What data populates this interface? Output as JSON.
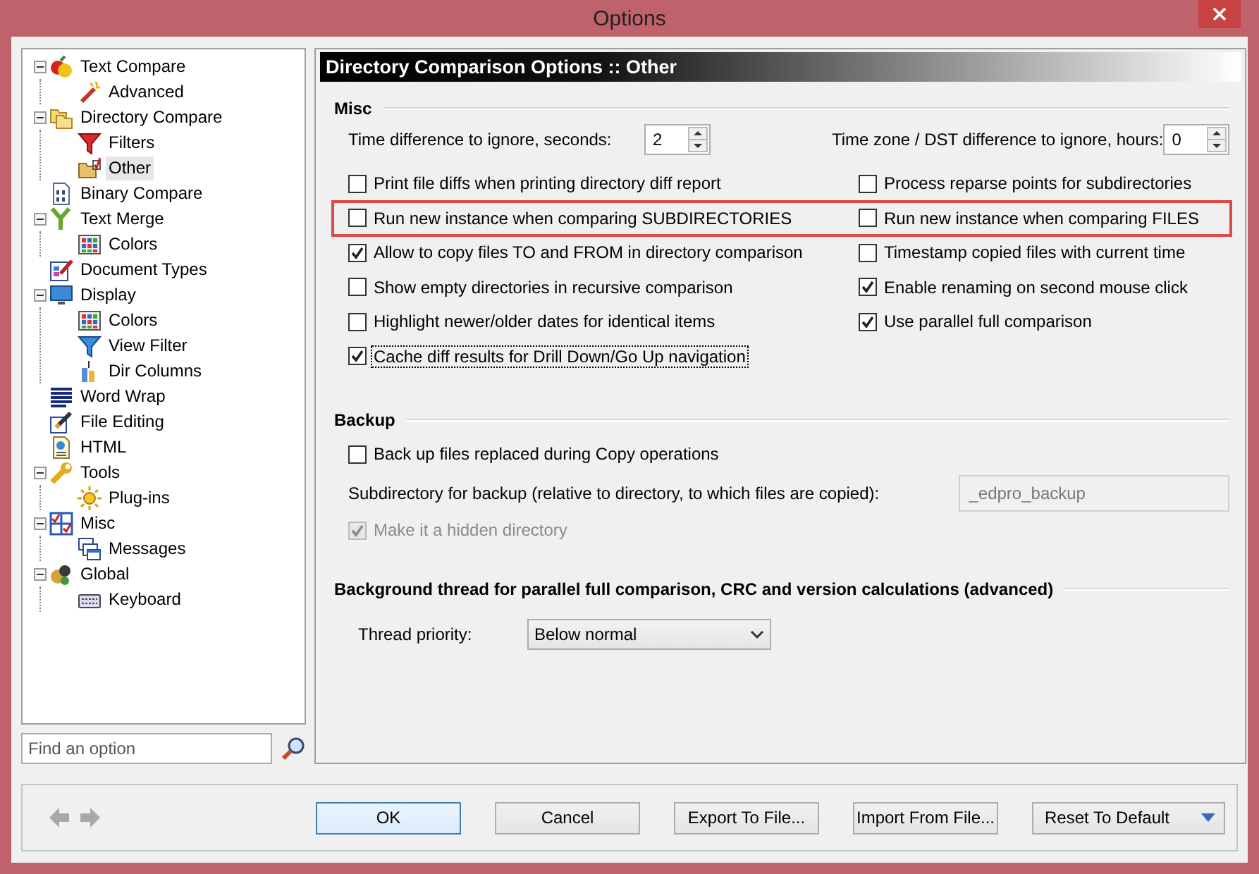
{
  "window": {
    "title": "Options"
  },
  "tree": [
    {
      "label": "Text Compare",
      "kind": "fruit",
      "expanded": true,
      "selected": false,
      "children": [
        {
          "label": "Advanced",
          "kind": "wand",
          "selected": false
        }
      ]
    },
    {
      "label": "Directory Compare",
      "kind": "folders",
      "expanded": true,
      "selected": false,
      "children": [
        {
          "label": "Filters",
          "kind": "funnel",
          "selected": false
        },
        {
          "label": "Other",
          "kind": "folder",
          "selected": true
        }
      ]
    },
    {
      "label": "Binary Compare",
      "kind": "binary",
      "selected": false
    },
    {
      "label": "Text Merge",
      "kind": "merge",
      "expanded": true,
      "selected": false,
      "children": [
        {
          "label": "Colors",
          "kind": "grid",
          "selected": false
        }
      ]
    },
    {
      "label": "Document Types",
      "kind": "doctypes",
      "selected": false
    },
    {
      "label": "Display",
      "kind": "monitor",
      "expanded": true,
      "selected": false,
      "children": [
        {
          "label": "Colors",
          "kind": "grid",
          "selected": false
        },
        {
          "label": "View Filter",
          "kind": "bluefunnel",
          "selected": false
        },
        {
          "label": "Dir Columns",
          "kind": "columns",
          "selected": false
        }
      ]
    },
    {
      "label": "Word Wrap",
      "kind": "lines",
      "selected": false
    },
    {
      "label": "File Editing",
      "kind": "pen",
      "selected": false
    },
    {
      "label": "HTML",
      "kind": "page",
      "selected": false
    },
    {
      "label": "Tools",
      "kind": "wrench",
      "expanded": true,
      "selected": false,
      "children": [
        {
          "label": "Plug-ins",
          "kind": "sun",
          "selected": false
        }
      ]
    },
    {
      "label": "Misc",
      "kind": "checks",
      "expanded": true,
      "selected": false,
      "children": [
        {
          "label": "Messages",
          "kind": "windows",
          "selected": false
        }
      ]
    },
    {
      "label": "Global",
      "kind": "globe",
      "expanded": true,
      "selected": false,
      "children": [
        {
          "label": "Keyboard",
          "kind": "keyboard",
          "selected": false
        }
      ]
    }
  ],
  "search": {
    "placeholder": "Find an option"
  },
  "page": {
    "title": "Directory Comparison Options :: Other"
  },
  "misc": {
    "heading": "Misc",
    "spinners": [
      {
        "label": "Time difference to ignore, seconds:",
        "value": "2"
      },
      {
        "label": "Time zone / DST difference to ignore, hours:",
        "value": "0"
      }
    ],
    "rows": [
      {
        "highlighted": false,
        "options": [
          {
            "label": "Print file diffs when printing directory diff report",
            "checked": false,
            "focused": false
          },
          {
            "label": "Process reparse points for subdirectories",
            "checked": false,
            "focused": false
          }
        ]
      },
      {
        "highlighted": true,
        "options": [
          {
            "label": "Run new instance when comparing SUBDIRECTORIES",
            "checked": false,
            "focused": false
          },
          {
            "label": "Run new instance when comparing FILES",
            "checked": false,
            "focused": false
          }
        ]
      },
      {
        "highlighted": false,
        "options": [
          {
            "label": "Allow to copy files TO and FROM in directory comparison",
            "checked": true,
            "focused": false
          },
          {
            "label": "Timestamp copied files with current time",
            "checked": false,
            "focused": false
          }
        ]
      },
      {
        "highlighted": false,
        "options": [
          {
            "label": "Show empty directories in recursive comparison",
            "checked": false,
            "focused": false
          },
          {
            "label": "Enable renaming on second mouse click",
            "checked": true,
            "focused": false
          }
        ]
      },
      {
        "highlighted": false,
        "options": [
          {
            "label": "Highlight newer/older dates for identical items",
            "checked": false,
            "focused": false
          },
          {
            "label": "Use parallel full comparison",
            "checked": true,
            "focused": false
          }
        ]
      },
      {
        "highlighted": false,
        "options": [
          {
            "label": "Cache diff results for Drill Down/Go Up navigation",
            "checked": true,
            "focused": true
          }
        ]
      }
    ]
  },
  "backup": {
    "heading": "Backup",
    "option": {
      "label": "Back up files replaced during Copy operations",
      "checked": false
    },
    "subdir": {
      "label": "Subdirectory for backup (relative to directory, to which files are copied):",
      "value": "_edpro_backup",
      "disabled": true
    },
    "hidden": {
      "label": "Make it a hidden directory",
      "checked": true,
      "disabled": true
    }
  },
  "thread": {
    "heading": "Background thread for parallel full comparison, CRC and version calculations (advanced)",
    "label": "Thread priority:",
    "value": "Below normal"
  },
  "buttons": [
    {
      "label": "OK",
      "default": true,
      "dropdown": false
    },
    {
      "label": "Cancel",
      "default": false,
      "dropdown": false
    },
    {
      "label": "Export To File...",
      "default": false,
      "dropdown": false
    },
    {
      "label": "Import From File...",
      "default": false,
      "dropdown": false
    },
    {
      "label": "Reset To Default",
      "default": false,
      "dropdown": true
    }
  ]
}
